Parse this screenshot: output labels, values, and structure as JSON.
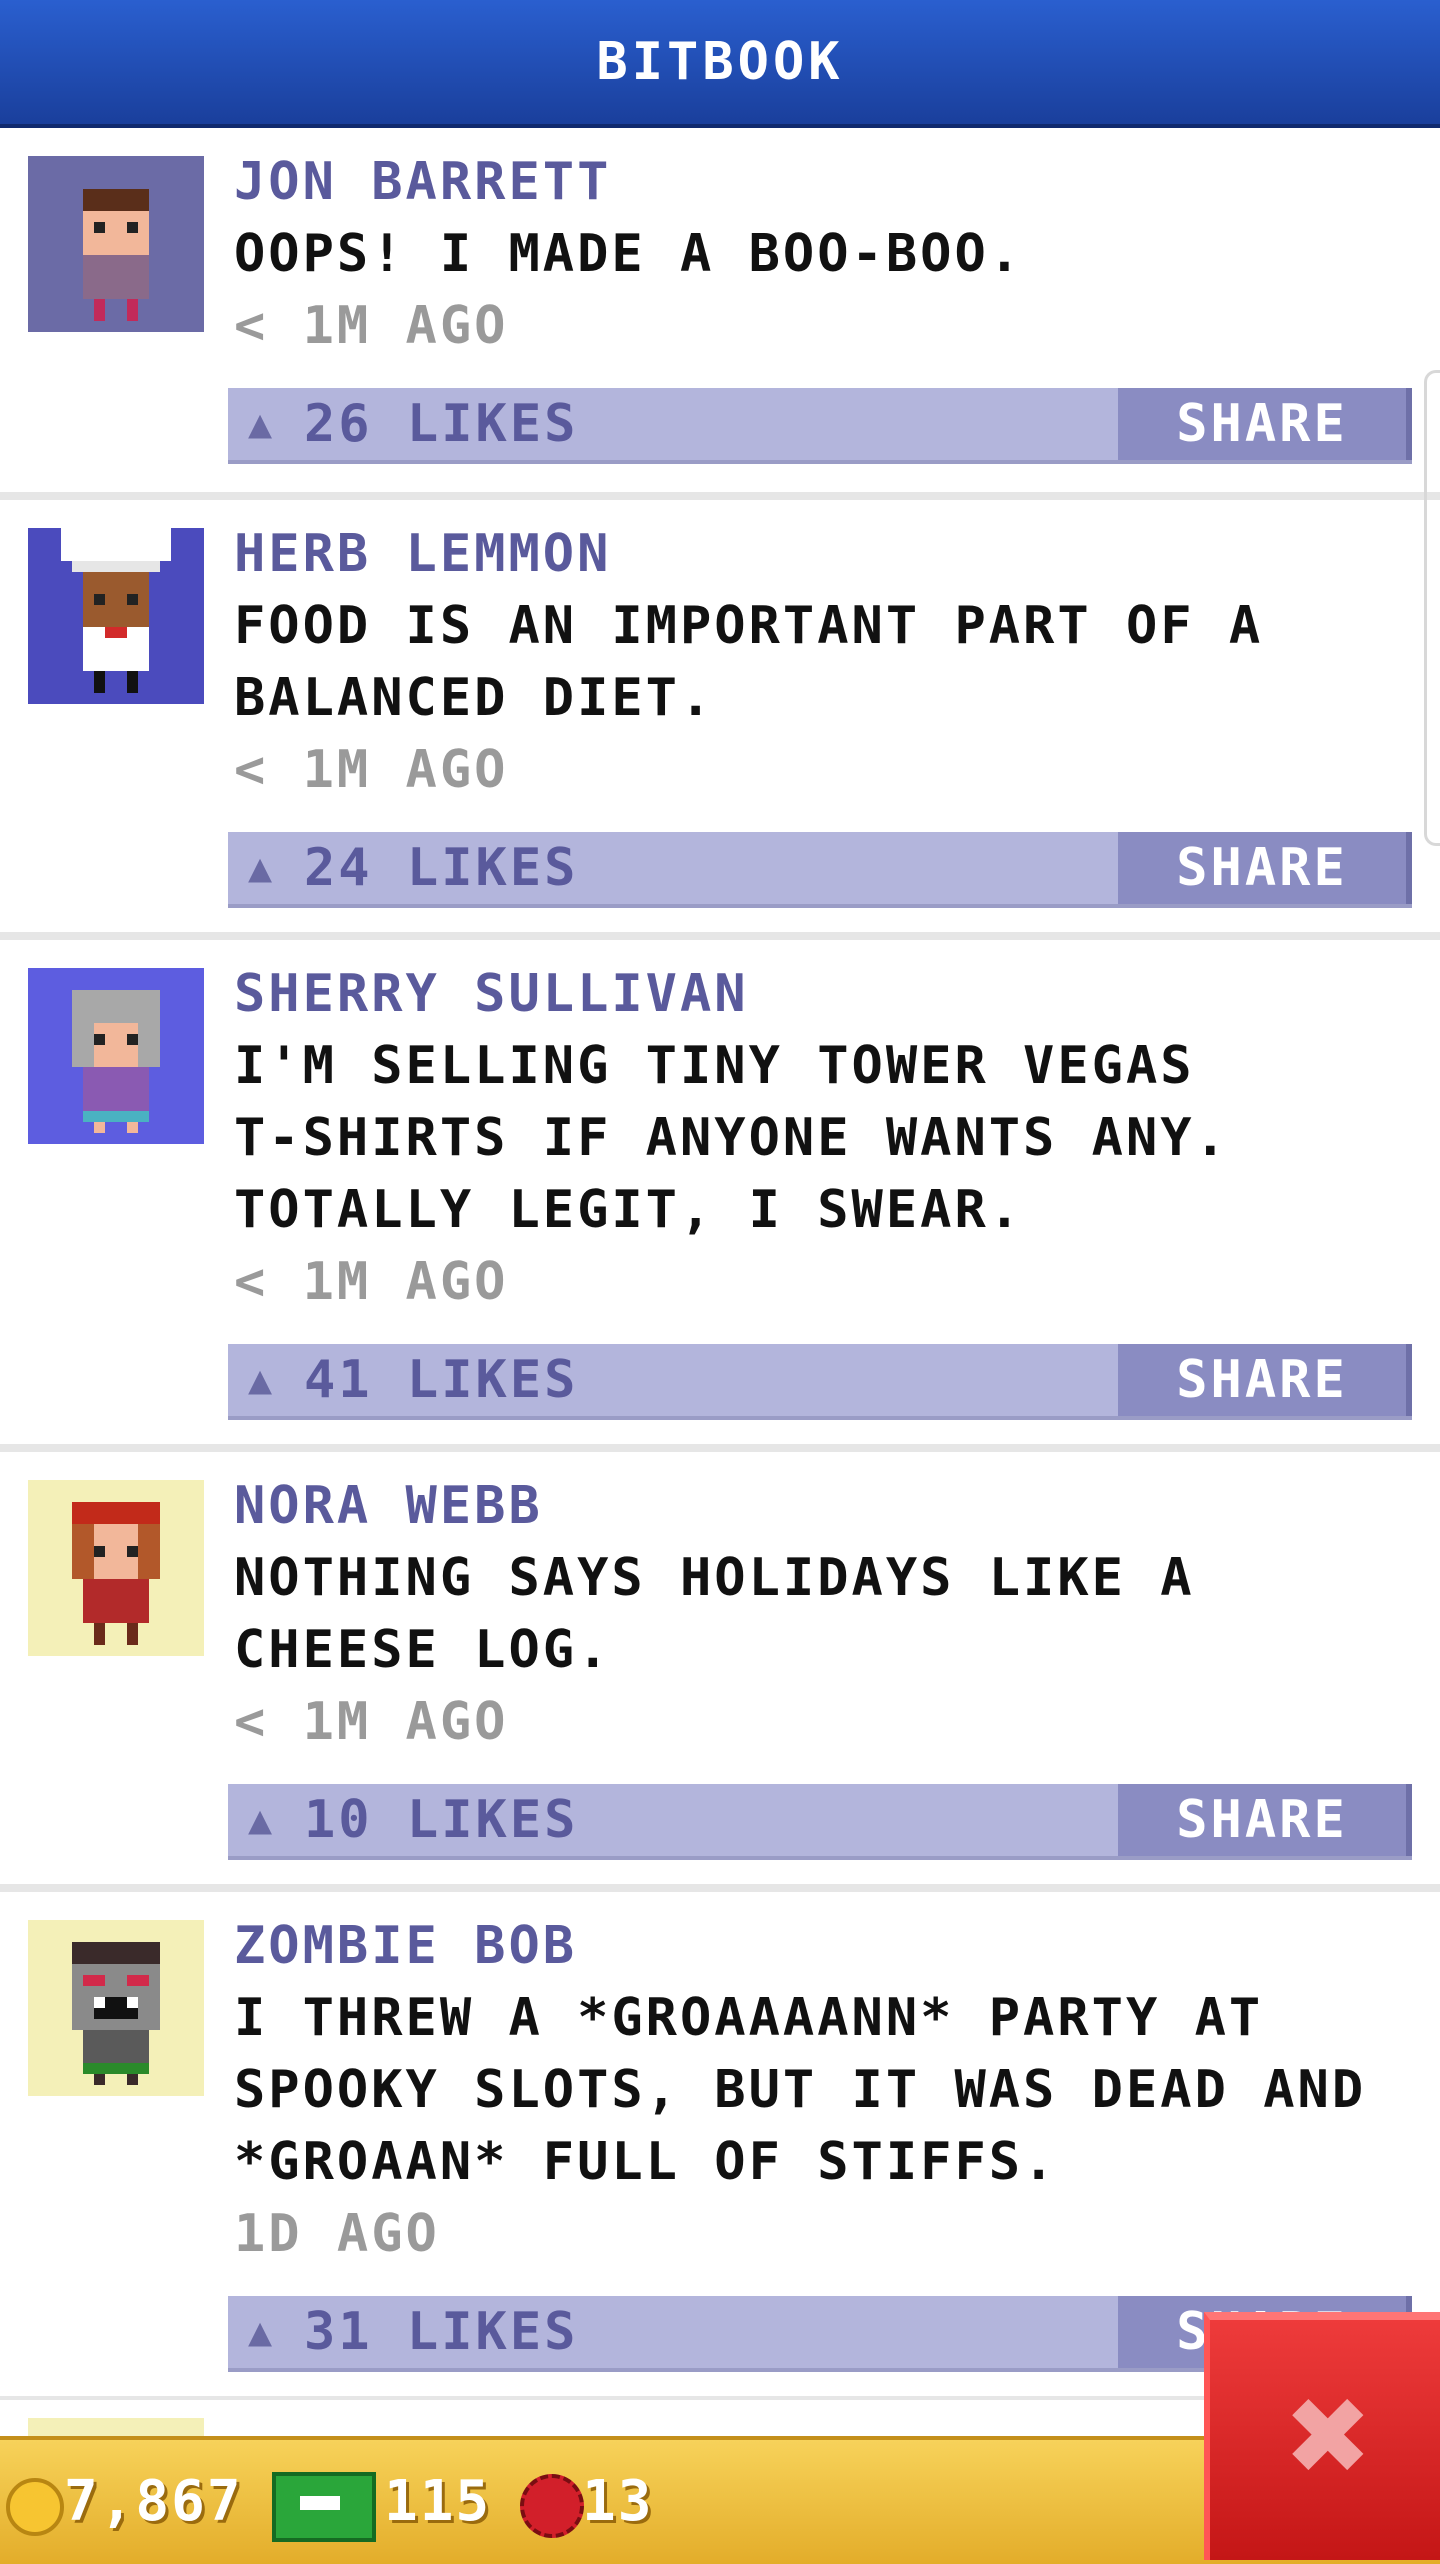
{
  "header": {
    "title": "BITBOOK"
  },
  "posts": [
    {
      "name": "JON BARRETT",
      "message": "OOPS! I MADE A BOO-BOO.",
      "time": "< 1M AGO",
      "likes": "26 LIKES",
      "share_label": "SHARE",
      "avatar_bg": "#6b6ba6",
      "avatar_icon": "person-avatar-icon"
    },
    {
      "name": "HERB LEMMON",
      "message": "FOOD IS AN IMPORTANT PART OF A\nBALANCED DIET.",
      "time": "< 1M AGO",
      "likes": "24 LIKES",
      "share_label": "SHARE",
      "avatar_bg": "#4b4bbd",
      "avatar_icon": "chef-avatar-icon"
    },
    {
      "name": "SHERRY SULLIVAN",
      "message": "I'M SELLING TINY TOWER VEGAS\nT-SHIRTS IF ANYONE WANTS ANY.\nTOTALLY LEGIT, I SWEAR.",
      "time": "< 1M AGO",
      "likes": "41 LIKES",
      "share_label": "SHARE",
      "avatar_bg": "#5d5de0",
      "avatar_icon": "grandma-avatar-icon"
    },
    {
      "name": "NORA WEBB",
      "message": "NOTHING SAYS HOLIDAYS LIKE A\nCHEESE LOG.",
      "time": "< 1M AGO",
      "likes": "10 LIKES",
      "share_label": "SHARE",
      "avatar_bg": "#f4f0b8",
      "avatar_icon": "redhead-avatar-icon"
    },
    {
      "name": "ZOMBIE BOB",
      "message": "I THREW A *GROAAAANN* PARTY AT\nSPOOKY SLOTS, BUT IT WAS DEAD AND\n*GROAAN* FULL OF STIFFS.",
      "time": "1D AGO",
      "likes": "31 LIKES",
      "share_label": "SHARE",
      "avatar_bg": "#f4f0b8",
      "avatar_icon": "zombie-avatar-icon"
    }
  ],
  "footer": {
    "coins": "7,867",
    "bux": "115",
    "tokens": "13",
    "coin_icon": "coin-icon",
    "bux_icon": "bux-icon",
    "token_icon": "token-icon"
  },
  "close_icon": "close-icon",
  "colors": {
    "header": "#1a3f9c",
    "likes_bar": "#b3b5dc",
    "share_button": "#8a8cc2",
    "footer": "#e3ad2a",
    "close_button": "#d21f1f"
  }
}
